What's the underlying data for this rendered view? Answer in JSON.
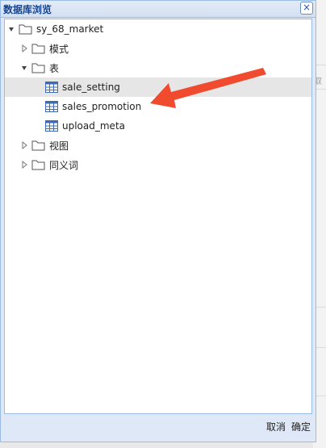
{
  "dialog": {
    "title": "数据库浏览",
    "close_symbol": "×"
  },
  "tree": {
    "root": {
      "label": "sy_68_market",
      "expanded": true
    },
    "nodes": [
      {
        "label": "模式",
        "expanded": false
      },
      {
        "label": "表",
        "expanded": true,
        "children": [
          {
            "label": "sale_setting",
            "selected": true
          },
          {
            "label": "sales_promotion",
            "selected": false
          },
          {
            "label": "upload_meta",
            "selected": false
          }
        ]
      },
      {
        "label": "视图",
        "expanded": false
      },
      {
        "label": "同义词",
        "expanded": false
      }
    ]
  },
  "footer": {
    "cancel_label": "取消",
    "confirm_label": "确定"
  },
  "background": {
    "fragment_text": "取"
  },
  "colors": {
    "accent_border": "#99bbe8",
    "title_text": "#15428b",
    "annotation_arrow": "#f04b2f",
    "selected_row": "#e6e6e6"
  },
  "icons": {
    "expanded": "triangle-down-icon",
    "collapsed": "triangle-right-icon",
    "folder": "folder-icon",
    "table": "table-grid-icon"
  }
}
